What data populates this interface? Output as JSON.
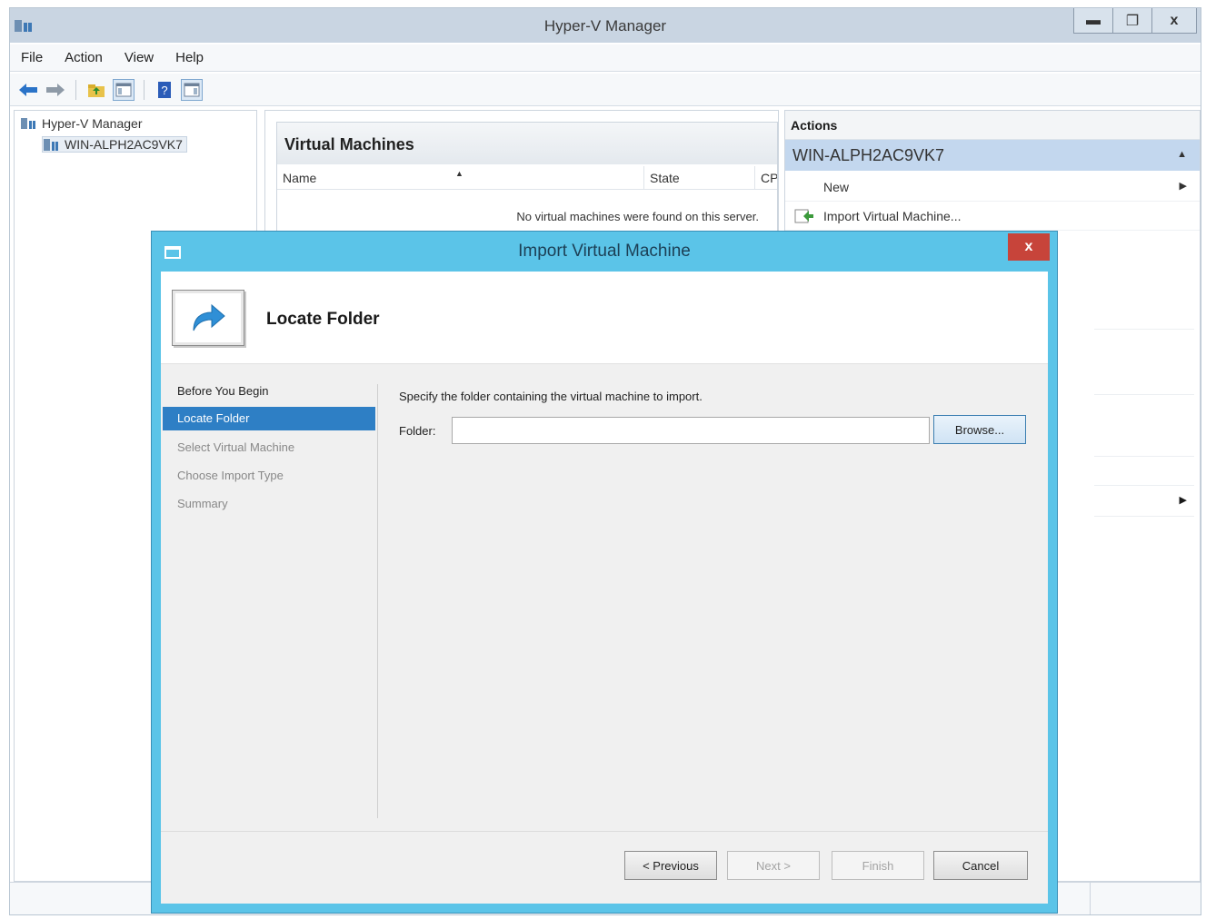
{
  "window": {
    "title": "Hyper-V Manager",
    "controls": {
      "minimize": "▬",
      "maximize": "❐",
      "close": "x"
    }
  },
  "menu": [
    "File",
    "Action",
    "View",
    "Help"
  ],
  "tree": {
    "root": "Hyper-V Manager",
    "server": "WIN-ALPH2AC9VK7"
  },
  "center": {
    "panel_title": "Virtual Machines",
    "columns": [
      "Name",
      "State",
      "CP"
    ],
    "empty_message": "No virtual machines were found on this server."
  },
  "actions": {
    "title": "Actions",
    "section": "WIN-ALPH2AC9VK7",
    "items": [
      "New",
      "Import Virtual Machine..."
    ]
  },
  "dialog": {
    "title": "Import Virtual Machine",
    "close": "x",
    "page_title": "Locate Folder",
    "steps": [
      "Before You Begin",
      "Locate Folder",
      "Select Virtual Machine",
      "Choose Import Type",
      "Summary"
    ],
    "current_step": "Locate Folder",
    "instruction": "Specify the folder containing the virtual machine to import.",
    "folder_label": "Folder:",
    "folder_value": "",
    "browse": "Browse...",
    "buttons": {
      "previous": "< Previous",
      "next": "Next >",
      "finish": "Finish",
      "cancel": "Cancel"
    }
  },
  "colors": {
    "dialog_frame": "#5bc4e8",
    "selected_step": "#2e7fc5",
    "close_button": "#c7443a",
    "actions_section": "#c3d7ee"
  }
}
